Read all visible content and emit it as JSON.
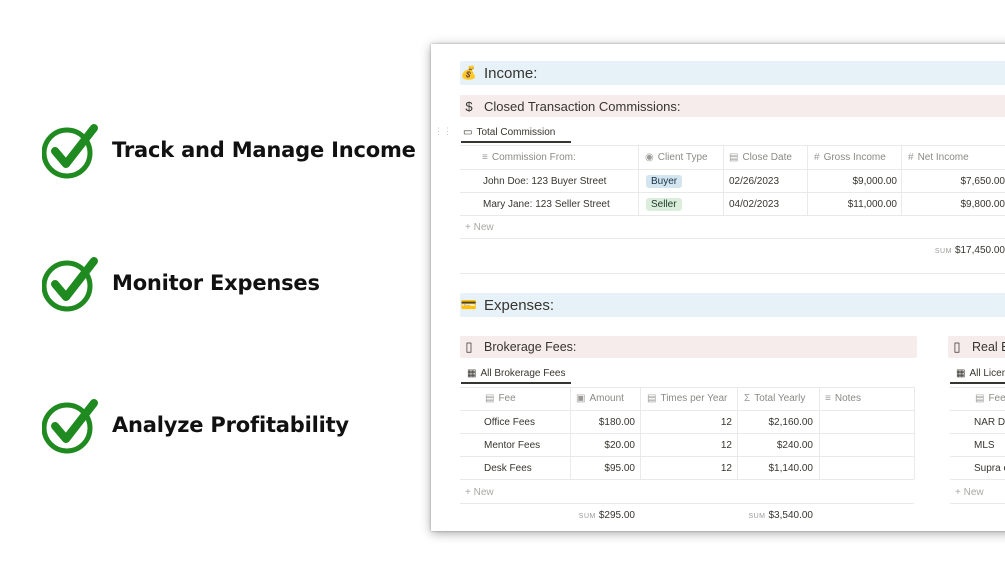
{
  "features": [
    {
      "label": "Track and Manage Income",
      "icon": "green-checkmark-icon"
    },
    {
      "label": "Monitor Expenses",
      "icon": "green-checkmark-icon"
    },
    {
      "label": "Analyze Profitability",
      "icon": "green-checkmark-icon"
    }
  ],
  "colors": {
    "check_green": "#1f8a1f",
    "income_header_bg": "#e7f1f8",
    "section_header_bg": "#f5eceb",
    "buyer_tag": "#d3e5ef",
    "seller_tag": "#dbeddb"
  },
  "income": {
    "emoji": "💰",
    "title": "Income:",
    "closed": {
      "emoji": "$",
      "title": "Closed Transaction Commissions:",
      "view_icon": "money-bill-icon",
      "view_tab": "Total Commission",
      "columns": [
        {
          "label": "Commission From:",
          "icon": "text-icon"
        },
        {
          "label": "Client Type",
          "icon": "select-icon"
        },
        {
          "label": "Close Date",
          "icon": "calendar-icon"
        },
        {
          "label": "Gross Income",
          "icon": "number-icon"
        },
        {
          "label": "Net Income",
          "icon": "number-icon"
        }
      ],
      "rows": [
        {
          "from": "John Doe: 123 Buyer Street",
          "client_type": "Buyer",
          "close_date": "02/26/2023",
          "gross": "$9,000.00",
          "net": "$7,650.00"
        },
        {
          "from": "Mary Jane: 123 Seller Street",
          "client_type": "Seller",
          "close_date": "04/02/2023",
          "gross": "$11,000.00",
          "net": "$9,800.00"
        }
      ],
      "new_label": "New",
      "sum_label": "SUM",
      "sum_net": "$17,450.00"
    }
  },
  "expenses": {
    "emoji": "💳",
    "title": "Expenses:",
    "brokerage": {
      "title": "Brokerage Fees:",
      "view_tab": "All Brokerage Fees",
      "columns": [
        {
          "label": "Fee",
          "icon": "doc-icon"
        },
        {
          "label": "Amount",
          "icon": "money-icon"
        },
        {
          "label": "Times per Year",
          "icon": "calendar-icon"
        },
        {
          "label": "Total Yearly",
          "icon": "sigma-icon"
        },
        {
          "label": "Notes",
          "icon": "text-icon"
        }
      ],
      "rows": [
        {
          "fee": "Office Fees",
          "amount": "$180.00",
          "times": "12",
          "total": "$2,160.00"
        },
        {
          "fee": "Mentor Fees",
          "amount": "$20.00",
          "times": "12",
          "total": "$240.00"
        },
        {
          "fee": "Desk Fees",
          "amount": "$95.00",
          "times": "12",
          "total": "$1,140.00"
        }
      ],
      "new_label": "New",
      "sum_label": "SUM",
      "sum_amount": "$295.00",
      "sum_total": "$3,540.00"
    },
    "realestate": {
      "title": "Real Es",
      "view_tab": "All Licen",
      "column": "Fee",
      "rows": [
        "NAR Du",
        "MLS",
        "Supra e"
      ],
      "new_label": "New"
    }
  }
}
